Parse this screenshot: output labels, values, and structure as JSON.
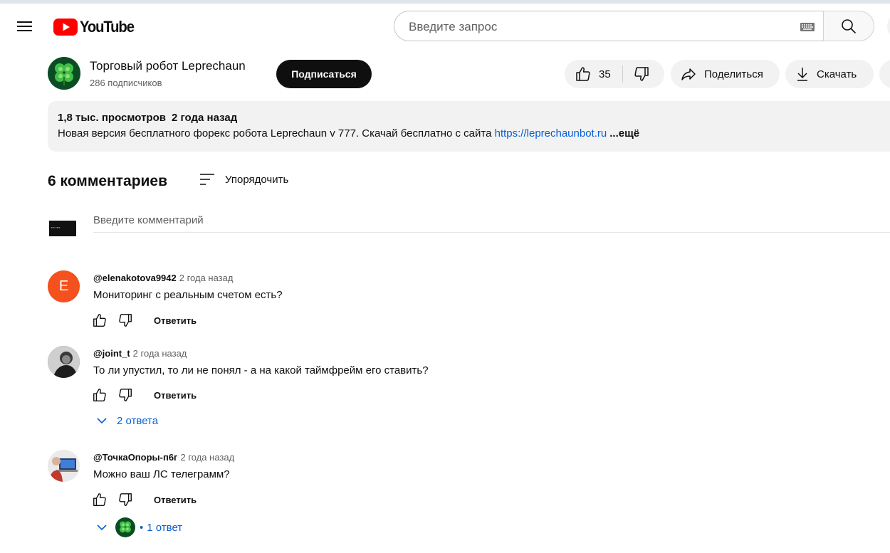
{
  "header": {
    "logo_text": "YouTube",
    "search_placeholder": "Введите запрос"
  },
  "channel": {
    "name": "Торговый робот Leprechaun",
    "subscribers": "286 подписчиков",
    "subscribe_label": "Подписаться"
  },
  "actions": {
    "likes": "35",
    "share_label": "Поделиться",
    "download_label": "Скачать"
  },
  "description": {
    "views": "1,8 тыс. просмотров",
    "date": "2 года назад",
    "text": "Новая версия бесплатного форекс робота Leprechaun v 777. Скачай бесплатно с сайта ",
    "link": "https://leprechaunbot.ru",
    "more_label": "...ещё"
  },
  "comments_section": {
    "count_label": "6 комментариев",
    "sort_label": "Упорядочить",
    "input_placeholder": "Введите комментарий"
  },
  "comments": [
    {
      "author": "@elenakotova9942",
      "time": "2 года назад",
      "text": "Мониторинг с реальным счетом есть?",
      "avatar_letter": "E",
      "reply_label": "Ответить"
    },
    {
      "author": "@joint_t",
      "time": "2 года назад",
      "text": "То ли упустил, то ли не понял - а на какой таймфрейм его ставить?",
      "reply_label": "Ответить",
      "replies_label": "2 ответа"
    },
    {
      "author": "@ТочкаОпоры-п6г",
      "time": "2 года назад",
      "text": "Можно ваш ЛС телеграмм?",
      "reply_label": "Ответить",
      "replies_label": "1 ответ"
    }
  ],
  "colors": {
    "youtube_red": "#ff0000",
    "link_blue": "#065fd4",
    "avatar_orange": "#f4511e",
    "chip_gray": "#f2f2f2"
  }
}
